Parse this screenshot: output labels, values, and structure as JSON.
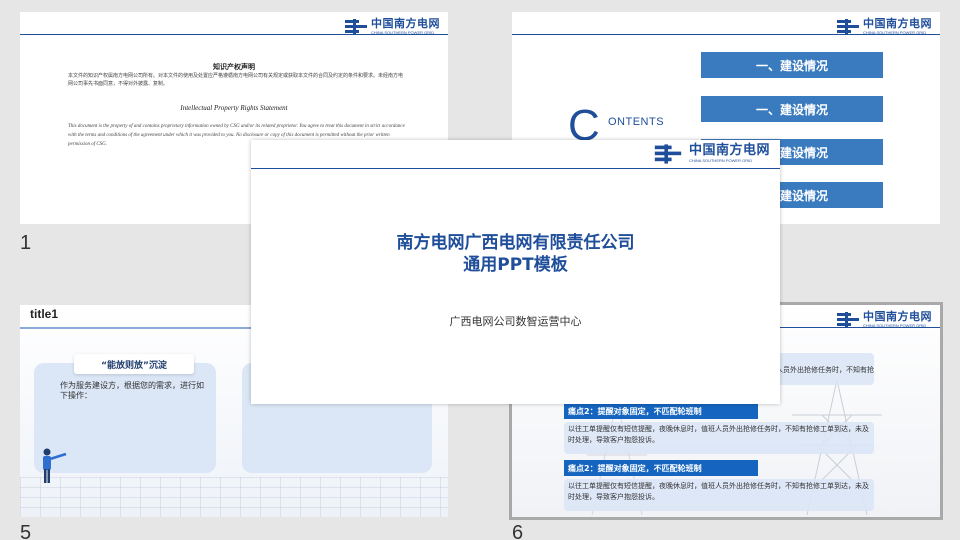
{
  "brand": {
    "logo_cn": "中国南方电网",
    "logo_en": "CHINA SOUTHERN POWER GRID",
    "color": "#1f4e9a"
  },
  "slides": {
    "s1": {
      "number": "1",
      "ip_title": "知识产权声明",
      "ip_text_1": "本文件的知识产权属南方电网公司所有。对本文件的使用及处置应严格遵循南方电网公司有关规定或获取本文件的合同及约定的条件和要求。未经南方电网公司事先书面同意，不得对外披露、复制。",
      "ip_en_title": "Intellectual Property Rights Statement",
      "ip_en_text": "This document is the property of and contains proprietary information owned by CSG and/or its related proprietor. You agree to treat this document in strict accordance with the terms and conditions of the agreement under which it was provided to you. No disclosure or copy of this document is permitted without the prior written permission of CSG."
    },
    "s2": {
      "contents_c": "C",
      "contents_word": "ONTENTS",
      "toc": [
        "一、建设情况",
        "一、建设情况",
        "一、建设情况",
        "一、建设情况"
      ]
    },
    "s5": {
      "number": "5",
      "title": "title1",
      "tag": "“能放则放”沉淀",
      "text": "作为服务建设方，根据您的需求，进行如下操作："
    },
    "s6": {
      "number": "6",
      "pain_1_text_partial": "值班人员外出抢修任务时，不知有抢",
      "pain_2_title": "痛点2：提醒对象固定，不匹配轮班制",
      "pain_2_text": "以往工单提醒仅有短信提醒，夜晚休息时，值班人员外出抢修任务时，不知有抢修工单到达，未及时处理，导致客户抱怨投诉。",
      "pain_3_title": "痛点2：提醒对象固定，不匹配轮班制",
      "pain_3_text": "以往工单提醒仅有短信提醒，夜晚休息时，值班人员外出抢修任务时，不知有抢修工单到达，未及时处理，导致客户抱怨投诉。"
    },
    "title_slide": {
      "line1": "南方电网广西电网有限责任公司",
      "line2": "通用PPT模板",
      "subtitle": "广西电网公司数智运营中心"
    }
  },
  "colors": {
    "toc_bar": "#3a7bbf",
    "pain_bar": "#1565c0",
    "card": "#dbe6f6"
  }
}
